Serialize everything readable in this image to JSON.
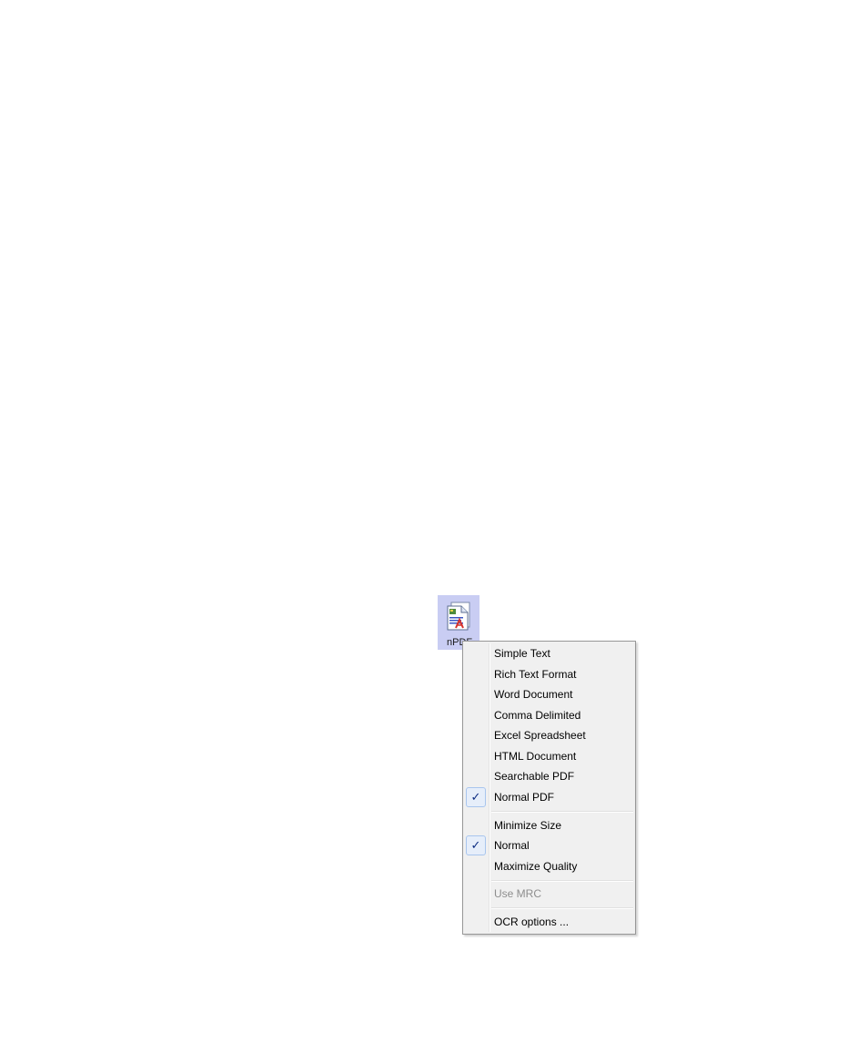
{
  "desktop_icon": {
    "label": "nPDF",
    "icon": "pdf-document-icon"
  },
  "context_menu": {
    "format_items": [
      {
        "label": "Simple Text",
        "checked": false
      },
      {
        "label": "Rich Text Format",
        "checked": false
      },
      {
        "label": "Word Document",
        "checked": false
      },
      {
        "label": "Comma Delimited",
        "checked": false
      },
      {
        "label": "Excel Spreadsheet",
        "checked": false
      },
      {
        "label": "HTML Document",
        "checked": false
      },
      {
        "label": "Searchable PDF",
        "checked": false
      },
      {
        "label": "Normal PDF",
        "checked": true
      }
    ],
    "quality_items": [
      {
        "label": "Minimize Size",
        "checked": false
      },
      {
        "label": "Normal",
        "checked": true
      },
      {
        "label": "Maximize Quality",
        "checked": false
      }
    ],
    "mrc_item": {
      "label": "Use MRC",
      "enabled": false
    },
    "ocr_item": {
      "label": "OCR options ..."
    },
    "check_glyph": "✓"
  },
  "colors": {
    "icon_selection": "#c9cdf3",
    "menu_background": "#f0f0f0",
    "check_highlight": "#e6eefa",
    "check_color": "#0c2c82"
  }
}
